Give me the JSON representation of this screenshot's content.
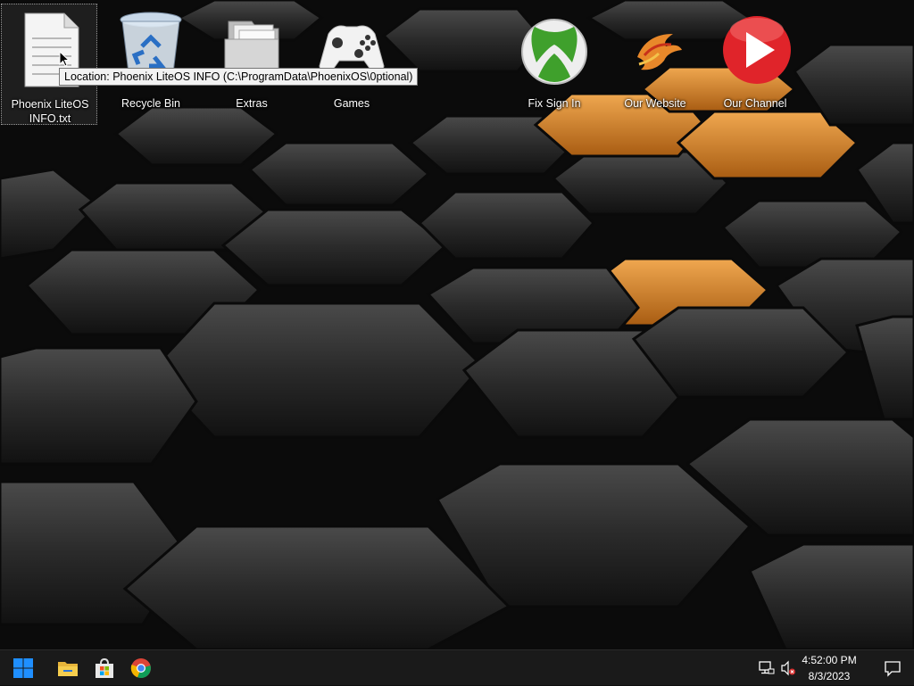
{
  "desktop": {
    "icons": [
      {
        "label": "Phoenix LiteOS INFO.txt",
        "icon": "text-file-icon"
      },
      {
        "label": "Recycle Bin",
        "icon": "recycle-bin-icon"
      },
      {
        "label": "Extras",
        "icon": "folder-icon"
      },
      {
        "label": "Games",
        "icon": "game-controller-icon"
      },
      {
        "label": "Fix Sign In",
        "icon": "xbox-icon"
      },
      {
        "label": "Our Website",
        "icon": "phoenix-logo-icon"
      },
      {
        "label": "Our Channel",
        "icon": "play-icon"
      }
    ],
    "tooltip": "Location: Phoenix LiteOS INFO (C:\\ProgramData\\PhoenixOS\\0ptional)"
  },
  "taskbar": {
    "pinned": [
      "windows-start-icon",
      "file-explorer-icon",
      "store-icon",
      "chrome-icon"
    ],
    "tray": [
      "network-icon",
      "volume-muted-icon"
    ],
    "time": "4:52:00 PM",
    "date": "8/3/2023",
    "notification_icon": "action-center-icon"
  },
  "colors": {
    "accent_orange": "#d8862a",
    "hex_dark": "#2a2a2a",
    "taskbar": "#1a1a1a",
    "xbox_green": "#3fa02c",
    "channel_red": "#e0242a"
  }
}
